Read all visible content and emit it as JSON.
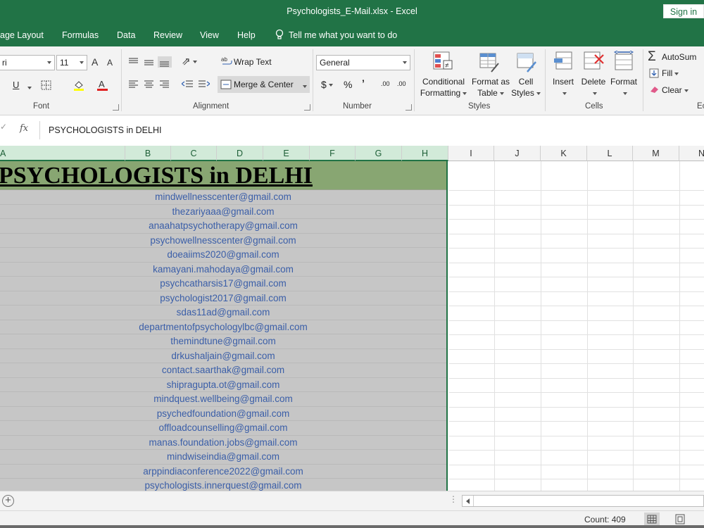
{
  "window": {
    "title": "Psychologists_E-Mail.xlsx  -  Excel",
    "signin": "Sign in"
  },
  "tabs": [
    "age Layout",
    "Formulas",
    "Data",
    "Review",
    "View",
    "Help"
  ],
  "tellme": "Tell me what you want to do",
  "ribbon": {
    "font_name": "ri",
    "font_size": "11",
    "grow_font": "A",
    "shrink_font": "A",
    "underline": "U",
    "wrap_text": "Wrap Text",
    "merge_center": "Merge & Center",
    "number_format": "General",
    "currency": "$",
    "percent": "%",
    "comma": "’",
    "inc_decimal": ".00",
    "dec_decimal": ".00",
    "conditional": [
      "Conditional",
      "Formatting"
    ],
    "format_table": [
      "Format as",
      "Table"
    ],
    "cell_styles": [
      "Cell",
      "Styles"
    ],
    "insert": "Insert",
    "delete": "Delete",
    "format": "Format",
    "autosum": "AutoSum",
    "fill": "Fill",
    "clear": "Clear",
    "groups": {
      "font": "Font",
      "alignment": "Alignment",
      "number": "Number",
      "styles": "Styles",
      "cells": "Cells",
      "editing": "Ec"
    }
  },
  "formula_bar": {
    "fx": "fx",
    "content": "PSYCHOLOGISTS in DELHI"
  },
  "columns": [
    "A",
    "B",
    "C",
    "D",
    "E",
    "F",
    "G",
    "H",
    "I",
    "J",
    "K",
    "L",
    "M",
    "N"
  ],
  "sheet": {
    "title": "PSYCHOLOGISTS in DELHI",
    "emails": [
      "mindwellnesscenter@gmail.com",
      "thezariyaaa@gmail.com",
      "anaahatpsychotherapy@gmail.com",
      "psychowellnesscenter@gmail.com",
      "doeaiims2020@gmail.com",
      "kamayani.mahodaya@gmail.com",
      "psychcatharsis17@gmail.com",
      "psychologist2017@gmail.com",
      "sdas11ad@gmail.com",
      "departmentofpsychologylbc@gmail.com",
      "themindtune@gmail.com",
      "drkushaljain@gmail.com",
      "contact.saarthak@gmail.com",
      "shipragupta.ot@gmail.com",
      "mindquest.wellbeing@gmail.com",
      "psychedfoundation@gmail.com",
      "offloadcounselling@gmail.com",
      "manas.foundation.jobs@gmail.com",
      "mindwiseindia@gmail.com",
      "arppindiaconference2022@gmail.com",
      "psychologists.innerquest@gmail.com"
    ]
  },
  "status": {
    "count": "Count: 409"
  }
}
